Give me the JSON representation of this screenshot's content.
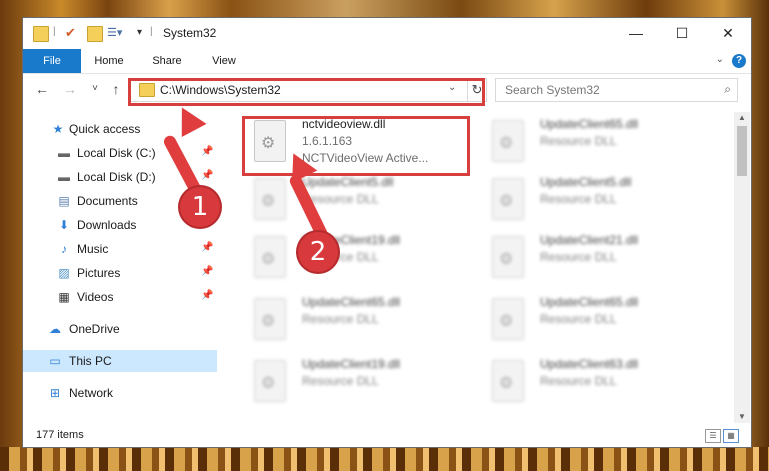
{
  "window": {
    "title": "System32"
  },
  "ribbon": {
    "tabs": [
      "File",
      "Home",
      "Share",
      "View"
    ],
    "help": "?"
  },
  "address": {
    "path": "C:\\Windows\\System32"
  },
  "search": {
    "placeholder": "Search System32"
  },
  "sidebar": {
    "items": [
      {
        "label": "Quick access"
      },
      {
        "label": "Local Disk (C:)"
      },
      {
        "label": "Local Disk (D:)"
      },
      {
        "label": "Documents"
      },
      {
        "label": "Downloads"
      },
      {
        "label": "Music"
      },
      {
        "label": "Pictures"
      },
      {
        "label": "Videos"
      },
      {
        "label": "OneDrive"
      },
      {
        "label": "This PC"
      },
      {
        "label": "Network"
      }
    ]
  },
  "files": [
    {
      "name": "nctvideoview.dll",
      "line2": "1.6.1.163",
      "line3": "NCTVideoView Active..."
    },
    {
      "name": "UpdateClient65.dll",
      "line2": "Resource DLL"
    },
    {
      "name": "UpdateClient5.dll",
      "line2": "Resource DLL"
    },
    {
      "name": "UpdateClient5.dll",
      "line2": "Resource DLL"
    },
    {
      "name": "UpdateClient19.dll",
      "line2": "Resource DLL"
    },
    {
      "name": "UpdateClient21.dll",
      "line2": "Resource DLL"
    },
    {
      "name": "UpdateClient65.dll",
      "line2": "Resource DLL"
    },
    {
      "name": "UpdateClient65.dll",
      "line2": "Resource DLL"
    },
    {
      "name": "UpdateClient19.dll",
      "line2": "Resource DLL"
    },
    {
      "name": "UpdateClient63.dll",
      "line2": "Resource DLL"
    }
  ],
  "status": {
    "items": "177 items"
  },
  "callouts": [
    "1",
    "2"
  ],
  "colors": {
    "accent": "#1979ca",
    "annotation": "#d73f3f",
    "selected": "#cce8ff"
  }
}
